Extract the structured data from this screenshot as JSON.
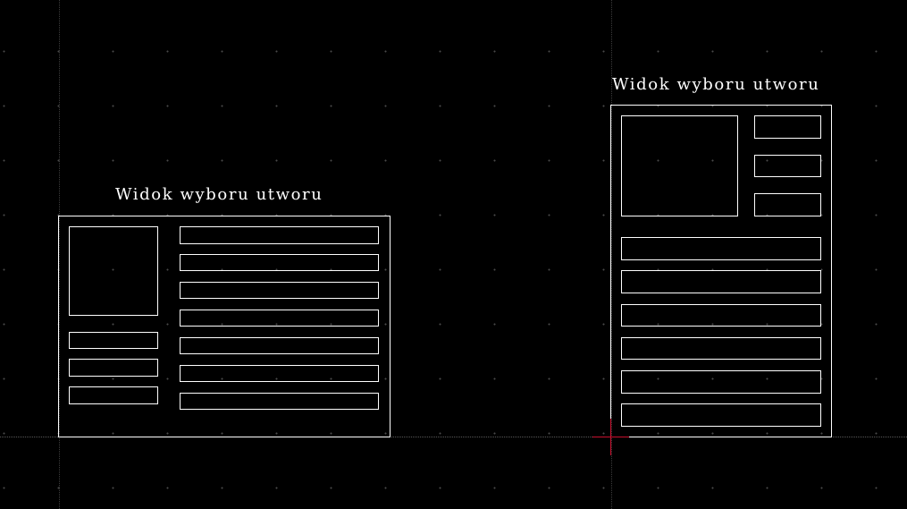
{
  "drawing": {
    "left_frame": {
      "title": "Widok wyboru utworu"
    },
    "right_frame": {
      "title": "Widok wyboru utworu"
    }
  },
  "colors": {
    "background": "#000000",
    "lines": "#ffffff",
    "cursor": "#c8102e",
    "grid_dots": "#4a4a4a"
  },
  "icons": [
    "crosshair-cursor-icon"
  ]
}
